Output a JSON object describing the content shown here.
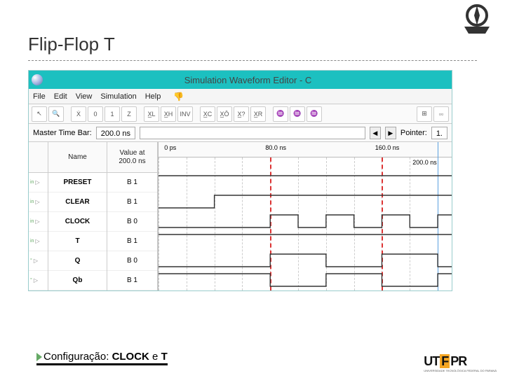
{
  "slide": {
    "title": "Flip-Flop T"
  },
  "caption": {
    "prefix": "Configuração: ",
    "bold1": "CLOCK",
    "mid": " e ",
    "bold2": "T"
  },
  "footer_logo": {
    "ut": "UT",
    "f": "F",
    "pr": "PR",
    "sub": "UNIVERSIDADE TECNOLÓGICA FEDERAL DO PARANÁ"
  },
  "app": {
    "title": "Simulation Waveform Editor - C",
    "menu": [
      "File",
      "Edit",
      "View",
      "Simulation",
      "Help"
    ],
    "toolbar_icons": [
      "pointer",
      "zoom-out",
      "xu",
      "force0",
      "force1",
      "forceZ",
      "xl",
      "xh",
      "inv",
      "xc",
      "xo",
      "x?",
      "xr",
      "w1",
      "w2",
      "w3",
      "grid",
      "snap"
    ],
    "timebar": {
      "label_master": "Master Time Bar:",
      "master_value": "200.0 ns",
      "nav_left": "◀",
      "nav_right": "▶",
      "label_pointer": "Pointer:",
      "pointer_value": "1."
    },
    "columns": {
      "handle": "",
      "name": "Name",
      "value": "Value at\n200.0 ns"
    },
    "signals": [
      {
        "dir": "in",
        "name": "PRESET",
        "value": "B 1"
      },
      {
        "dir": "in",
        "name": "CLEAR",
        "value": "B 1"
      },
      {
        "dir": "in",
        "name": "CLOCK",
        "value": "B 0"
      },
      {
        "dir": "in",
        "name": "T",
        "value": "B 1"
      },
      {
        "dir": "out",
        "name": "Q",
        "value": "B 0"
      },
      {
        "dir": "out",
        "name": "Qb",
        "value": "B 1"
      }
    ],
    "ruler": {
      "ticks": [
        "0 ps",
        "80.0 ns",
        "160.0 ns"
      ],
      "marker": "200.0 ns"
    }
  },
  "chart_data": {
    "type": "timing",
    "time_unit": "ns",
    "time_range": [
      0,
      210
    ],
    "grid_interval": 20,
    "cursors_red": [
      80,
      160
    ],
    "cursor_blue": 200,
    "signals": [
      {
        "name": "PRESET",
        "levels": [
          [
            0,
            1
          ],
          [
            210,
            1
          ]
        ]
      },
      {
        "name": "CLEAR",
        "levels": [
          [
            0,
            0
          ],
          [
            40,
            0
          ],
          [
            40,
            1
          ],
          [
            210,
            1
          ]
        ]
      },
      {
        "name": "CLOCK",
        "levels": [
          [
            0,
            0
          ],
          [
            80,
            0
          ],
          [
            80,
            1
          ],
          [
            100,
            1
          ],
          [
            100,
            0
          ],
          [
            120,
            0
          ],
          [
            120,
            1
          ],
          [
            140,
            1
          ],
          [
            140,
            0
          ],
          [
            160,
            0
          ],
          [
            160,
            1
          ],
          [
            180,
            1
          ],
          [
            180,
            0
          ],
          [
            200,
            0
          ],
          [
            200,
            1
          ],
          [
            210,
            1
          ]
        ]
      },
      {
        "name": "T",
        "levels": [
          [
            0,
            1
          ],
          [
            210,
            1
          ]
        ]
      },
      {
        "name": "Q",
        "levels": [
          [
            0,
            0
          ],
          [
            80,
            0
          ],
          [
            80,
            1
          ],
          [
            120,
            1
          ],
          [
            120,
            0
          ],
          [
            160,
            0
          ],
          [
            160,
            1
          ],
          [
            200,
            1
          ],
          [
            200,
            0
          ],
          [
            210,
            0
          ]
        ]
      },
      {
        "name": "Qb",
        "levels": [
          [
            0,
            1
          ],
          [
            80,
            1
          ],
          [
            80,
            0
          ],
          [
            120,
            0
          ],
          [
            120,
            1
          ],
          [
            160,
            1
          ],
          [
            160,
            0
          ],
          [
            200,
            0
          ],
          [
            200,
            1
          ],
          [
            210,
            1
          ]
        ]
      }
    ]
  }
}
